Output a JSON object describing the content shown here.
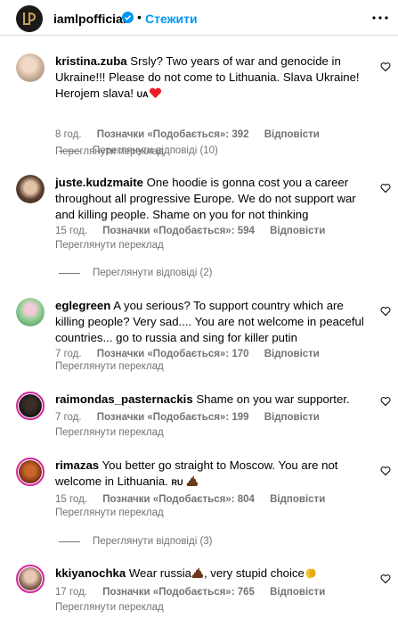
{
  "header": {
    "username": "iamlpofficial",
    "separator": "•",
    "follow_label": "Стежити"
  },
  "comments": [
    {
      "username": "kristina.zuba",
      "text": "Srsly? Two years of war and genocide in Ukraine!!! Please do not come to Lithuania. Slava Ukraine! Herojem slava!",
      "flag": "UA",
      "emoji_icon": "red-heart",
      "time": "8 год.",
      "likes": "Позначки «Подобається»: 392",
      "reply": "Відповісти",
      "translate": "Переглянути переклад",
      "view_replies": "Переглянути відповіді (10)"
    },
    {
      "username": "juste.kudzmaite",
      "text": "One hoodie is gonna cost you a career throughout all progressive Europe. We do not support war and killing people. Shame on you for not thinking",
      "time": "15 год.",
      "likes": "Позначки «Подобається»: 594",
      "reply": "Відповісти",
      "translate": "Переглянути переклад",
      "view_replies": "Переглянути відповіді (2)"
    },
    {
      "username": "eglegreen",
      "text": "A you serious? To support country which are killing people? Very sad.... You are not welcome in peaceful countries... go to russia and sing for killer putin",
      "time": "7 год.",
      "likes": "Позначки «Подобається»: 170",
      "reply": "Відповісти",
      "translate": "Переглянути переклад"
    },
    {
      "username": "raimondas_pasternackis",
      "text": "Shame on you war supporter.",
      "time": "7 год.",
      "likes": "Позначки «Подобається»: 199",
      "reply": "Відповісти",
      "translate": "Переглянути переклад"
    },
    {
      "username": "rimazas",
      "text": "You better go straight to Moscow. You are not welcome in Lithuania.",
      "flag": "RU",
      "emoji_icon": "poop",
      "time": "15 год.",
      "likes": "Позначки «Подобається»: 804",
      "reply": "Відповісти",
      "translate": "Переглянути переклад",
      "view_replies": "Переглянути відповіді (3)"
    },
    {
      "username": "kkiyanochka",
      "text": "Wear russia",
      "text2": ", very stupid choice",
      "emoji_icon": "poop",
      "emoji_icon2": "clapping-hands",
      "time": "17 год.",
      "likes": "Позначки «Подобається»: 765",
      "reply": "Відповісти",
      "translate": "Переглянути переклад"
    }
  ],
  "colors": {
    "accent": "#0095f6",
    "muted": "#737373",
    "heart": "#ed1c24",
    "ring": "#d6249f"
  }
}
